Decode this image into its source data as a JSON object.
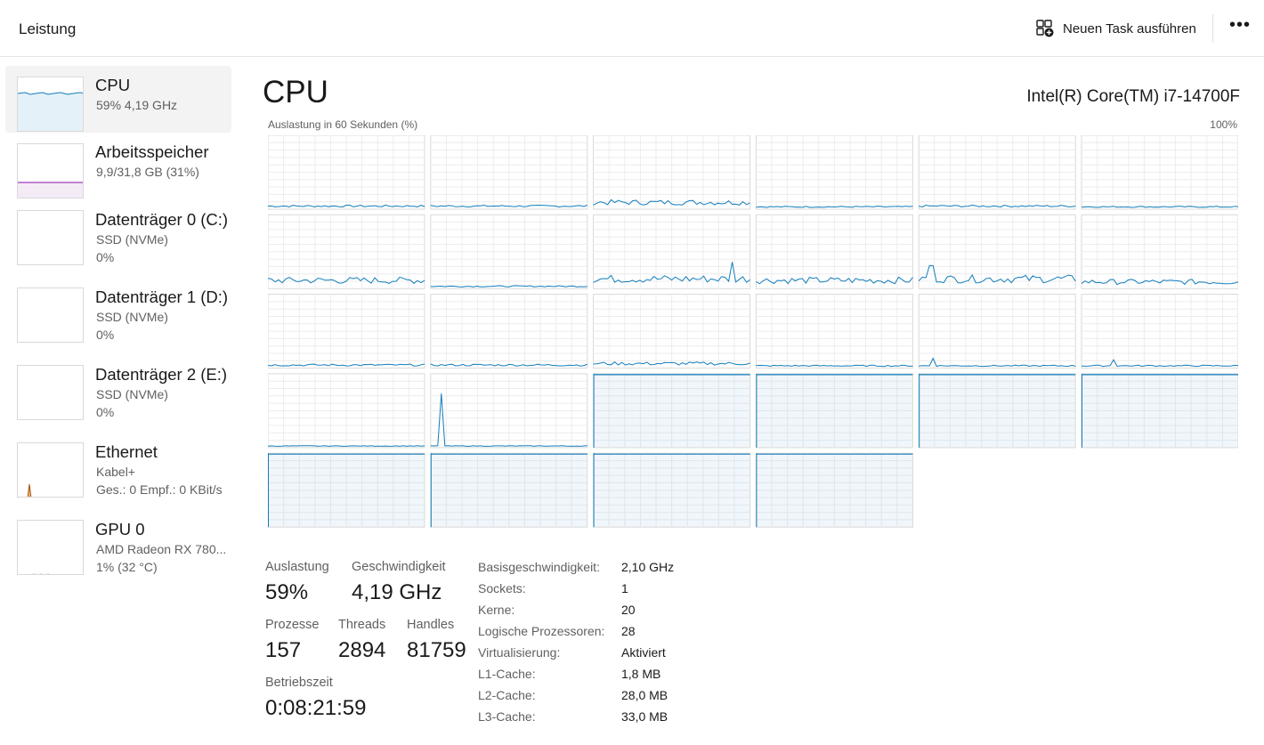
{
  "header": {
    "title": "Leistung",
    "run_task_label": "Neuen Task ausführen",
    "run_task_icon": "add-task-icon",
    "more_label": "•••"
  },
  "sidebar": {
    "items": [
      {
        "name": "CPU",
        "sub1": "59%  4,19 GHz",
        "sub2": "",
        "selected": true,
        "graph_color": "#117dbb"
      },
      {
        "name": "Arbeitsspeicher",
        "sub1": "9,9/31,8 GB (31%)",
        "sub2": "",
        "selected": false,
        "graph_color": "#8b12ae"
      },
      {
        "name": "Datenträger 0 (C:)",
        "sub1": "SSD (NVMe)",
        "sub2": "0%",
        "selected": false
      },
      {
        "name": "Datenträger 1 (D:)",
        "sub1": "SSD (NVMe)",
        "sub2": "0%",
        "selected": false
      },
      {
        "name": "Datenträger 2 (E:)",
        "sub1": "SSD (NVMe)",
        "sub2": "0%",
        "selected": false
      },
      {
        "name": "Ethernet",
        "sub1": "Kabel+",
        "sub2": "Ges.: 0 Empf.: 0 KBit/s",
        "selected": false,
        "graph_color": "#a74f01"
      },
      {
        "name": "GPU 0",
        "sub1": "AMD Radeon RX 780...",
        "sub2": "1% (32 °C)",
        "selected": false
      }
    ]
  },
  "main": {
    "title": "CPU",
    "cpu_model": "Intel(R) Core(TM) i7-14700F",
    "chart_label": "Auslastung in 60 Sekunden (%)",
    "chart_max": "100%",
    "logical_processor_count": 28,
    "accent_color": "#117dbb"
  },
  "stats": {
    "utilization_label": "Auslastung",
    "utilization_value": "59%",
    "speed_label": "Geschwindigkeit",
    "speed_value": "4,19 GHz",
    "processes_label": "Prozesse",
    "processes_value": "157",
    "threads_label": "Threads",
    "threads_value": "2894",
    "handles_label": "Handles",
    "handles_value": "81759",
    "uptime_label": "Betriebszeit",
    "uptime_value": "0:08:21:59"
  },
  "specs": [
    {
      "key": "Basisgeschwindigkeit:",
      "value": "2,10 GHz"
    },
    {
      "key": "Sockets:",
      "value": "1"
    },
    {
      "key": "Kerne:",
      "value": "20"
    },
    {
      "key": "Logische Prozessoren:",
      "value": "28"
    },
    {
      "key": "Virtualisierung:",
      "value": "Aktiviert"
    },
    {
      "key": "L1-Cache:",
      "value": "1,8 MB"
    },
    {
      "key": "L2-Cache:",
      "value": "28,0 MB"
    },
    {
      "key": "L3-Cache:",
      "value": "33,0 MB"
    }
  ]
}
